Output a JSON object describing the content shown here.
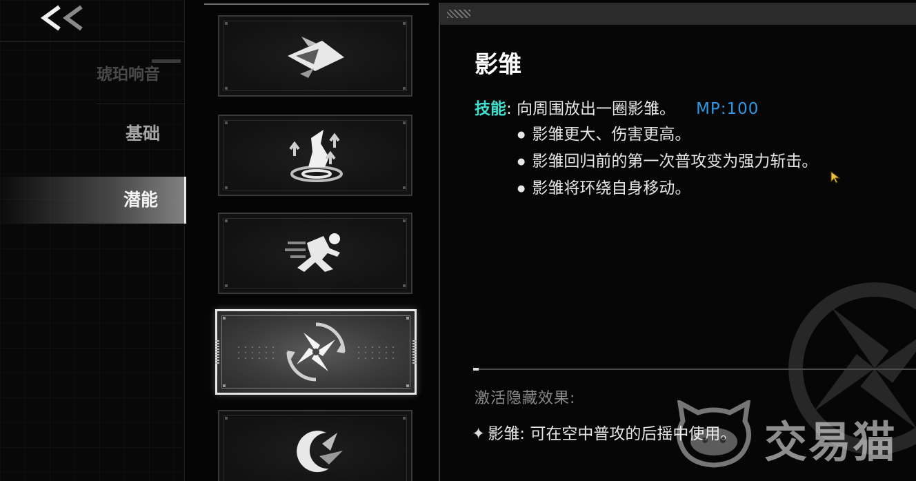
{
  "nav": {
    "back_icon": "double-chevron-left-icon",
    "items": [
      {
        "label": "琥珀响音",
        "state": "dim"
      },
      {
        "label": "基础",
        "state": "normal"
      },
      {
        "label": "潜能",
        "state": "active"
      }
    ]
  },
  "cards": [
    {
      "icon": "dash-arrow-icon",
      "selected": false
    },
    {
      "icon": "foot-upgrade-icon",
      "selected": false
    },
    {
      "icon": "running-figure-icon",
      "selected": false
    },
    {
      "icon": "shuriken-icon",
      "selected": true
    },
    {
      "icon": "crescent-slash-icon",
      "selected": false
    }
  ],
  "detail": {
    "title": "影雏",
    "skill_label": "技能",
    "skill_sep": ":",
    "skill_text": " 向周围放出一圈影雏。",
    "mp": "MP:100",
    "bullets": [
      "影雏更大、伤害更高。",
      "影雏回归前的第一次普攻变为强力斩击。",
      "影雏将环绕自身移动。"
    ],
    "hidden_title": "激活隐藏效果:",
    "hidden_star": "✦",
    "hidden_text": "影雏: 可在空中普攻的后摇中使用。"
  },
  "watermark": {
    "text": "交易猫"
  },
  "colors": {
    "skill_label": "#3fe0d0",
    "mp": "#2f98e6",
    "cursor": "#e8c341"
  }
}
